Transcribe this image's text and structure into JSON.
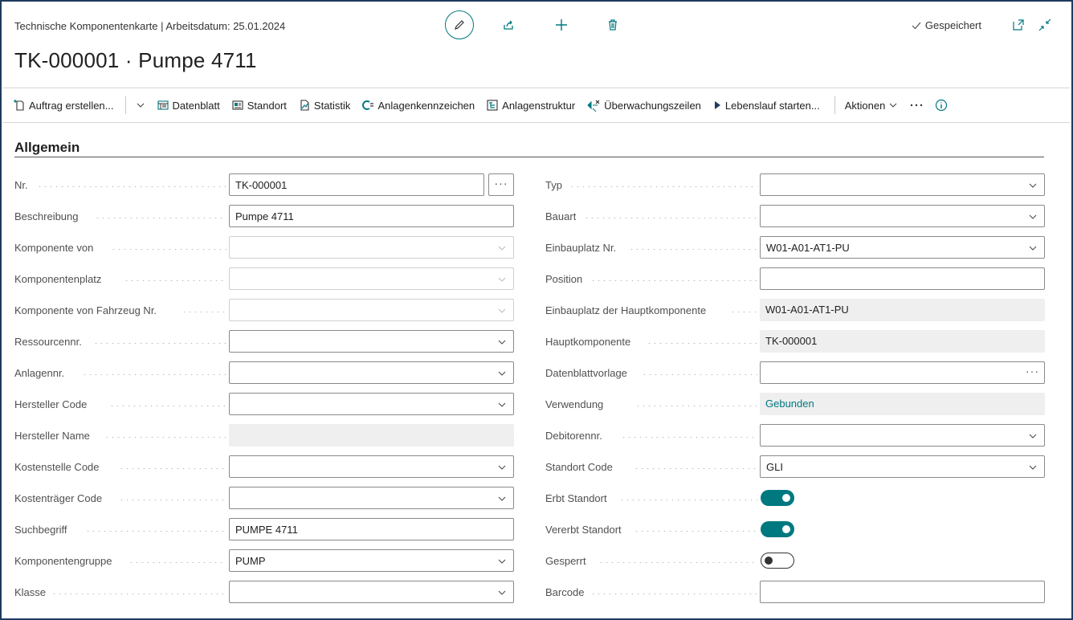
{
  "header": {
    "subtitle": "Technische Komponentenkarte | Arbeitsdatum: 25.01.2024",
    "title": "TK-000001 · Pumpe 4711",
    "status": "Gespeichert"
  },
  "actions": {
    "auftrag": "Auftrag erstellen...",
    "datenblatt": "Datenblatt",
    "standort": "Standort",
    "statistik": "Statistik",
    "anlagenkennzeichen": "Anlagenkennzeichen",
    "anlagenstruktur": "Anlagenstruktur",
    "ueberwachung": "Überwachungszeilen",
    "lebenslauf": "Lebenslauf starten...",
    "aktionen": "Aktionen"
  },
  "section": {
    "title": "Allgemein"
  },
  "left": {
    "nr": {
      "label": "Nr.",
      "value": "TK-000001"
    },
    "beschreibung": {
      "label": "Beschreibung",
      "value": "Pumpe 4711"
    },
    "komponente_von": {
      "label": "Komponente von",
      "value": ""
    },
    "komponentenplatz": {
      "label": "Komponentenplatz",
      "value": ""
    },
    "fahrzeug": {
      "label": "Komponente von Fahrzeug Nr.",
      "value": ""
    },
    "ressource": {
      "label": "Ressourcennr.",
      "value": ""
    },
    "anlagen": {
      "label": "Anlagennr.",
      "value": ""
    },
    "hersteller_code": {
      "label": "Hersteller Code",
      "value": ""
    },
    "hersteller_name": {
      "label": "Hersteller Name",
      "value": ""
    },
    "kostenstelle": {
      "label": "Kostenstelle Code",
      "value": ""
    },
    "kostentraeger": {
      "label": "Kostenträger Code",
      "value": ""
    },
    "suchbegriff": {
      "label": "Suchbegriff",
      "value": "PUMPE 4711"
    },
    "gruppe": {
      "label": "Komponentengruppe",
      "value": "PUMP"
    },
    "klasse": {
      "label": "Klasse",
      "value": ""
    }
  },
  "right": {
    "typ": {
      "label": "Typ",
      "value": ""
    },
    "bauart": {
      "label": "Bauart",
      "value": ""
    },
    "einbauplatz": {
      "label": "Einbauplatz Nr.",
      "value": "W01-A01-AT1-PU"
    },
    "position": {
      "label": "Position",
      "value": ""
    },
    "einbauplatz_haupt": {
      "label": "Einbauplatz der Hauptkomponente",
      "value": "W01-A01-AT1-PU"
    },
    "hauptkomponente": {
      "label": "Hauptkomponente",
      "value": "TK-000001"
    },
    "datenblattvorlage": {
      "label": "Datenblattvorlage",
      "value": ""
    },
    "verwendung": {
      "label": "Verwendung",
      "value": "Gebunden"
    },
    "debitor": {
      "label": "Debitorennr.",
      "value": ""
    },
    "standort_code": {
      "label": "Standort Code",
      "value": "GLI"
    },
    "erbt": {
      "label": "Erbt Standort",
      "value": true
    },
    "vererbt": {
      "label": "Vererbt Standort",
      "value": true
    },
    "gesperrt": {
      "label": "Gesperrt",
      "value": false
    },
    "barcode": {
      "label": "Barcode",
      "value": ""
    }
  },
  "colors": {
    "accent": "#00787f",
    "frame": "#1f3a5f"
  }
}
